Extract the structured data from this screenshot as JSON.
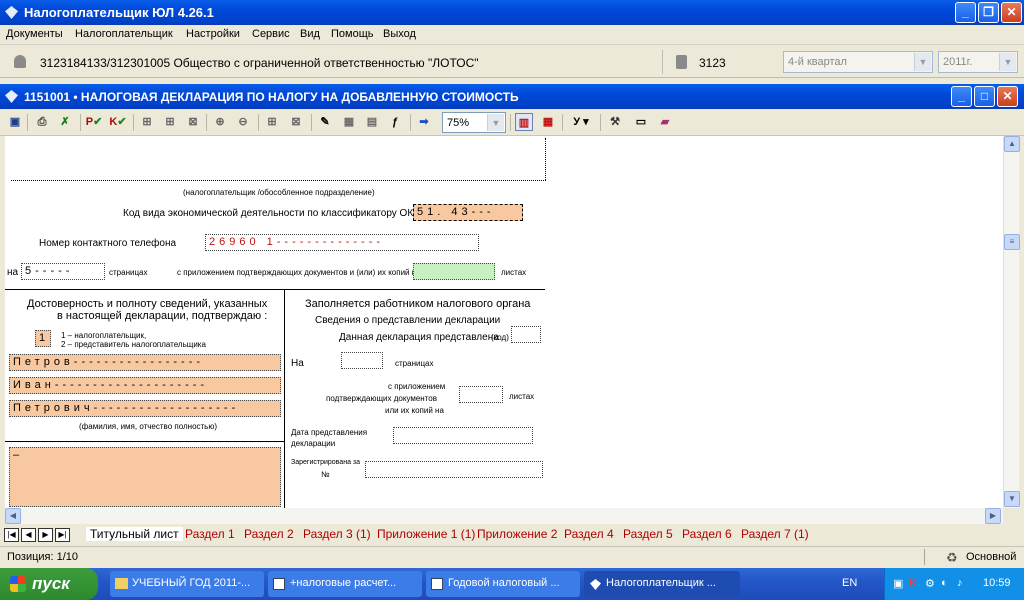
{
  "app": {
    "title": "Налогоплательщик ЮЛ 4.26.1"
  },
  "menu": [
    "Документы",
    "Налогоплательщик",
    "Настройки",
    "Сервис",
    "Вид",
    "Помощь",
    "Выход"
  ],
  "org": {
    "name": "3123184133/312301005 Общество с ограниченной ответственностью \"ЛОТОС\"",
    "code": "3123",
    "period": "4-й квартал",
    "year": "2011г."
  },
  "document": {
    "title": "1151001 • НАЛОГОВАЯ ДЕКЛАРАЦИЯ ПО НАЛОГУ НА ДОБАВЛЕННУЮ СТОИМОСТЬ"
  },
  "toolbar": {
    "zoom": "75%",
    "p_label": "P",
    "k_label": "K",
    "u_label": "У"
  },
  "form": {
    "taxpayer_caption": "(налогоплательщик /обособленное подразделение)",
    "okved_label": "Код вида экономической деятельности по классификатору ОКВЭД",
    "okved_value": "51. 43---",
    "phone_label": "Номер контактного телефона",
    "phone_value": "26960 1--------------",
    "pages_prefix": "на",
    "pages_value": "5-----",
    "pages_suffix": "страницах",
    "attach_label": "с приложением подтверждающих документов и (или) их копий на",
    "sheets_suffix": "листах",
    "confirm_title_1": "Достоверность и полноту сведений, указанных",
    "confirm_title_2": "в настоящей декларации, подтверждаю :",
    "signer_code": "1",
    "signer_opt1": "1 – налогоплательщик,",
    "signer_opt2": "2 – представитель налогоплательщика",
    "surname": "Петров-----------------",
    "firstname": "Иван--------------------",
    "patronymic": "Петрович-------------------",
    "fio_caption": "(фамилия, имя, отчество полностью)",
    "extra_value": "–",
    "tax_office_title": "Заполняется работником налогового органа",
    "submission_title": "Сведения о представлении декларации",
    "submitted_label": "Данная декларация представлена",
    "submitted_code": "(код)",
    "on_label": "На",
    "pages_label": "страницах",
    "attach_1": "с приложением",
    "attach_2": "подтверждающих документов",
    "attach_3": "или их копий на",
    "sheets_label": "листах",
    "date_label_1": "Дата представления",
    "date_label_2": "декларации",
    "reg_label_1": "Зарегистрирована за",
    "reg_label_2": "№"
  },
  "tabs": [
    "Титульный лист",
    "Раздел 1",
    "Раздел 2",
    "Раздел 3 (1)",
    "Приложение 1 (1)",
    "Приложение 2",
    "Раздел 4",
    "Раздел 5",
    "Раздел 6",
    "Раздел 7 (1)"
  ],
  "status": {
    "position": "Позиция: 1/10",
    "mode": "Основной"
  },
  "taskbar": {
    "start": "пуск",
    "tasks": [
      "УЧЕБНЫЙ ГОД 2011-...",
      "+налоговые расчет...",
      "Годовой налоговый ...",
      "Налогоплательщик ..."
    ],
    "lang": "EN",
    "time": "10:59"
  }
}
